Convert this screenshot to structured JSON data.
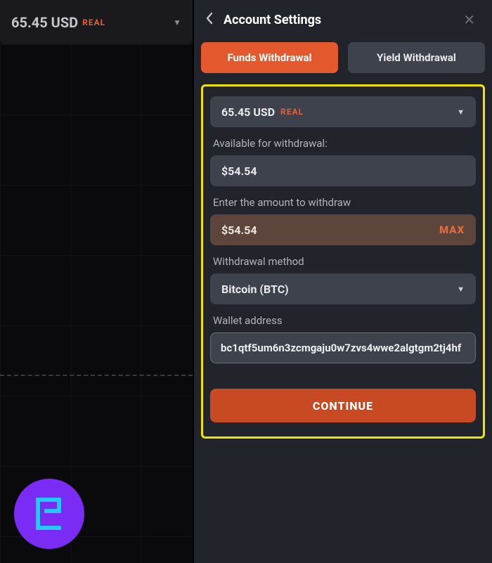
{
  "left": {
    "balance": "65.45 USD",
    "tag": "REAL"
  },
  "panel": {
    "title": "Account Settings",
    "tabs": {
      "funds": "Funds Withdrawal",
      "yield": "Yield Withdrawal"
    },
    "account": {
      "balance": "65.45 USD",
      "tag": "REAL"
    },
    "labels": {
      "available": "Available for withdrawal:",
      "enter_amount": "Enter the amount to withdraw",
      "method": "Withdrawal method",
      "wallet": "Wallet address"
    },
    "values": {
      "available": "$54.54",
      "amount": "$54.54",
      "max": "MAX",
      "method": "Bitcoin (BTC)",
      "wallet": "bc1qtf5um6n3zcmgaju0w7zvs4wwe2algtgm2tj4hf"
    },
    "continue": "CONTINUE"
  }
}
